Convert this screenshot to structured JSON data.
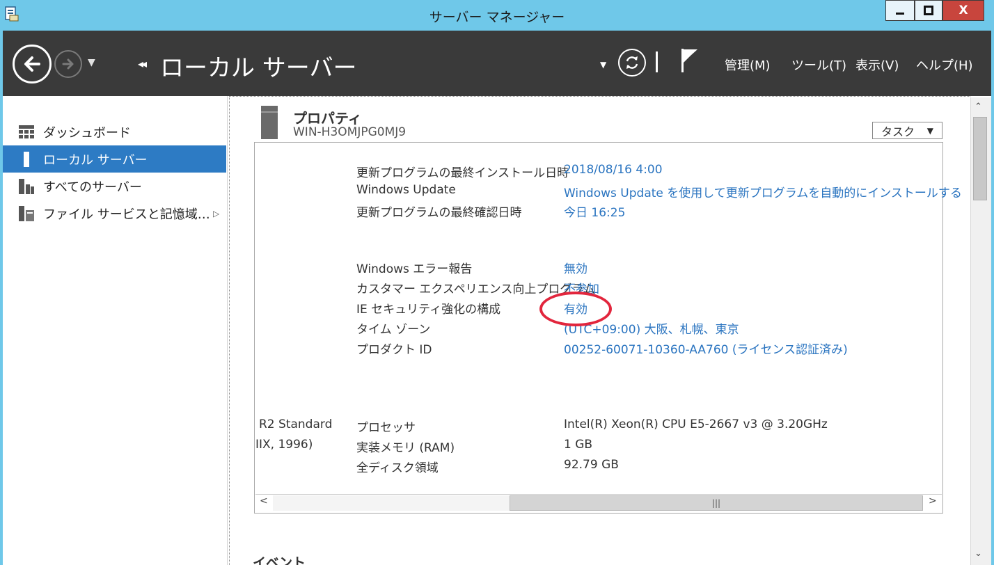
{
  "window": {
    "title": "サーバー マネージャー",
    "min_label": "",
    "close_label": "X"
  },
  "header": {
    "page_title": "ローカル サーバー",
    "breadcrumb_arrows": "◂◂",
    "menus": [
      "管理(M)",
      "ツール(T)",
      "表示(V)",
      "ヘルプ(H)"
    ]
  },
  "sidebar": {
    "items": [
      {
        "label": "ダッシュボード",
        "icon": "dashboard-icon",
        "active": false
      },
      {
        "label": "ローカル サーバー",
        "icon": "local-server-icon",
        "active": true
      },
      {
        "label": "すべてのサーバー",
        "icon": "all-servers-icon",
        "active": false
      },
      {
        "label": "ファイル サービスと記憶域…",
        "icon": "file-services-icon",
        "active": false
      }
    ]
  },
  "properties": {
    "title": "プロパティ",
    "hostname": "WIN-H3OMJPG0MJ9",
    "tasks_label": "タスク",
    "group1": [
      {
        "label": "更新プログラムの最終インストール日時",
        "value": "2018/08/16 4:00"
      },
      {
        "label": "Windows Update",
        "value": "Windows Update を使用して更新プログラムを自動的にインストールする"
      },
      {
        "label": "更新プログラムの最終確認日時",
        "value": "今日 16:25"
      }
    ],
    "group2": [
      {
        "label": "Windows エラー報告",
        "value": "無効"
      },
      {
        "label": "カスタマー エクスペリエンス向上プログラム",
        "value": "不参加"
      },
      {
        "label": "IE セキュリティ強化の構成",
        "value": "有効"
      },
      {
        "label": "タイム ゾーン",
        "value": "(UTC+09:00) 大阪、札幌、東京"
      },
      {
        "label": "プロダクト ID",
        "value": "00252-60071-10360-AA760 (ライセンス認証済み)"
      }
    ],
    "group3": [
      {
        "label": "プロセッサ",
        "value": "Intel(R) Xeon(R) CPU E5-2667 v3 @ 3.20GHz"
      },
      {
        "label": "実装メモリ (RAM)",
        "value": "1 GB"
      },
      {
        "label": "全ディスク領域",
        "value": "92.79 GB"
      }
    ],
    "clipped_left": [
      "R2 Standard",
      "IIX, 1996)"
    ]
  },
  "events": {
    "label": "イベント"
  },
  "colors": {
    "titlebar": "#6fc8e9",
    "header": "#3a3a3a",
    "active_item": "#2d7bc4",
    "link": "#2a74c0",
    "highlight": "#e2263d"
  }
}
